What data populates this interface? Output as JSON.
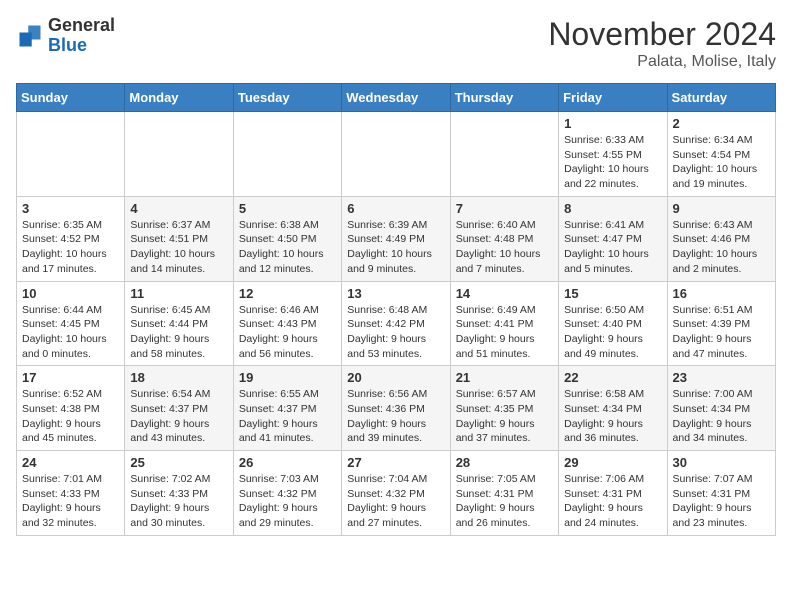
{
  "header": {
    "logo": {
      "general": "General",
      "blue": "Blue"
    },
    "month": "November 2024",
    "location": "Palata, Molise, Italy"
  },
  "weekdays": [
    "Sunday",
    "Monday",
    "Tuesday",
    "Wednesday",
    "Thursday",
    "Friday",
    "Saturday"
  ],
  "weeks": [
    [
      null,
      null,
      null,
      null,
      null,
      {
        "day": "1",
        "sunrise": "Sunrise: 6:33 AM",
        "sunset": "Sunset: 4:55 PM",
        "daylight": "Daylight: 10 hours and 22 minutes."
      },
      {
        "day": "2",
        "sunrise": "Sunrise: 6:34 AM",
        "sunset": "Sunset: 4:54 PM",
        "daylight": "Daylight: 10 hours and 19 minutes."
      }
    ],
    [
      {
        "day": "3",
        "sunrise": "Sunrise: 6:35 AM",
        "sunset": "Sunset: 4:52 PM",
        "daylight": "Daylight: 10 hours and 17 minutes."
      },
      {
        "day": "4",
        "sunrise": "Sunrise: 6:37 AM",
        "sunset": "Sunset: 4:51 PM",
        "daylight": "Daylight: 10 hours and 14 minutes."
      },
      {
        "day": "5",
        "sunrise": "Sunrise: 6:38 AM",
        "sunset": "Sunset: 4:50 PM",
        "daylight": "Daylight: 10 hours and 12 minutes."
      },
      {
        "day": "6",
        "sunrise": "Sunrise: 6:39 AM",
        "sunset": "Sunset: 4:49 PM",
        "daylight": "Daylight: 10 hours and 9 minutes."
      },
      {
        "day": "7",
        "sunrise": "Sunrise: 6:40 AM",
        "sunset": "Sunset: 4:48 PM",
        "daylight": "Daylight: 10 hours and 7 minutes."
      },
      {
        "day": "8",
        "sunrise": "Sunrise: 6:41 AM",
        "sunset": "Sunset: 4:47 PM",
        "daylight": "Daylight: 10 hours and 5 minutes."
      },
      {
        "day": "9",
        "sunrise": "Sunrise: 6:43 AM",
        "sunset": "Sunset: 4:46 PM",
        "daylight": "Daylight: 10 hours and 2 minutes."
      }
    ],
    [
      {
        "day": "10",
        "sunrise": "Sunrise: 6:44 AM",
        "sunset": "Sunset: 4:45 PM",
        "daylight": "Daylight: 10 hours and 0 minutes."
      },
      {
        "day": "11",
        "sunrise": "Sunrise: 6:45 AM",
        "sunset": "Sunset: 4:44 PM",
        "daylight": "Daylight: 9 hours and 58 minutes."
      },
      {
        "day": "12",
        "sunrise": "Sunrise: 6:46 AM",
        "sunset": "Sunset: 4:43 PM",
        "daylight": "Daylight: 9 hours and 56 minutes."
      },
      {
        "day": "13",
        "sunrise": "Sunrise: 6:48 AM",
        "sunset": "Sunset: 4:42 PM",
        "daylight": "Daylight: 9 hours and 53 minutes."
      },
      {
        "day": "14",
        "sunrise": "Sunrise: 6:49 AM",
        "sunset": "Sunset: 4:41 PM",
        "daylight": "Daylight: 9 hours and 51 minutes."
      },
      {
        "day": "15",
        "sunrise": "Sunrise: 6:50 AM",
        "sunset": "Sunset: 4:40 PM",
        "daylight": "Daylight: 9 hours and 49 minutes."
      },
      {
        "day": "16",
        "sunrise": "Sunrise: 6:51 AM",
        "sunset": "Sunset: 4:39 PM",
        "daylight": "Daylight: 9 hours and 47 minutes."
      }
    ],
    [
      {
        "day": "17",
        "sunrise": "Sunrise: 6:52 AM",
        "sunset": "Sunset: 4:38 PM",
        "daylight": "Daylight: 9 hours and 45 minutes."
      },
      {
        "day": "18",
        "sunrise": "Sunrise: 6:54 AM",
        "sunset": "Sunset: 4:37 PM",
        "daylight": "Daylight: 9 hours and 43 minutes."
      },
      {
        "day": "19",
        "sunrise": "Sunrise: 6:55 AM",
        "sunset": "Sunset: 4:37 PM",
        "daylight": "Daylight: 9 hours and 41 minutes."
      },
      {
        "day": "20",
        "sunrise": "Sunrise: 6:56 AM",
        "sunset": "Sunset: 4:36 PM",
        "daylight": "Daylight: 9 hours and 39 minutes."
      },
      {
        "day": "21",
        "sunrise": "Sunrise: 6:57 AM",
        "sunset": "Sunset: 4:35 PM",
        "daylight": "Daylight: 9 hours and 37 minutes."
      },
      {
        "day": "22",
        "sunrise": "Sunrise: 6:58 AM",
        "sunset": "Sunset: 4:34 PM",
        "daylight": "Daylight: 9 hours and 36 minutes."
      },
      {
        "day": "23",
        "sunrise": "Sunrise: 7:00 AM",
        "sunset": "Sunset: 4:34 PM",
        "daylight": "Daylight: 9 hours and 34 minutes."
      }
    ],
    [
      {
        "day": "24",
        "sunrise": "Sunrise: 7:01 AM",
        "sunset": "Sunset: 4:33 PM",
        "daylight": "Daylight: 9 hours and 32 minutes."
      },
      {
        "day": "25",
        "sunrise": "Sunrise: 7:02 AM",
        "sunset": "Sunset: 4:33 PM",
        "daylight": "Daylight: 9 hours and 30 minutes."
      },
      {
        "day": "26",
        "sunrise": "Sunrise: 7:03 AM",
        "sunset": "Sunset: 4:32 PM",
        "daylight": "Daylight: 9 hours and 29 minutes."
      },
      {
        "day": "27",
        "sunrise": "Sunrise: 7:04 AM",
        "sunset": "Sunset: 4:32 PM",
        "daylight": "Daylight: 9 hours and 27 minutes."
      },
      {
        "day": "28",
        "sunrise": "Sunrise: 7:05 AM",
        "sunset": "Sunset: 4:31 PM",
        "daylight": "Daylight: 9 hours and 26 minutes."
      },
      {
        "day": "29",
        "sunrise": "Sunrise: 7:06 AM",
        "sunset": "Sunset: 4:31 PM",
        "daylight": "Daylight: 9 hours and 24 minutes."
      },
      {
        "day": "30",
        "sunrise": "Sunrise: 7:07 AM",
        "sunset": "Sunset: 4:31 PM",
        "daylight": "Daylight: 9 hours and 23 minutes."
      }
    ]
  ]
}
